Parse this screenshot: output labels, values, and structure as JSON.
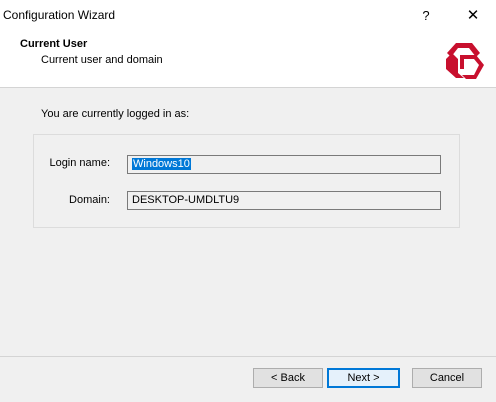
{
  "window": {
    "title": "Configuration Wizard",
    "help_label": "?",
    "close_label": "✕"
  },
  "header": {
    "title": "Current User",
    "subtitle": "Current user and domain",
    "logo_icon": "company-logo-icon"
  },
  "main": {
    "intro": "You are currently logged in as:",
    "login_label": "Login name:",
    "login_value": "Windows10",
    "domain_label": "Domain:",
    "domain_value": "DESKTOP-UMDLTU9"
  },
  "footer": {
    "back_label": "< Back",
    "next_label": "Next >",
    "cancel_label": "Cancel"
  },
  "colors": {
    "accent": "#0078d7",
    "logo_red": "#c8102e"
  }
}
